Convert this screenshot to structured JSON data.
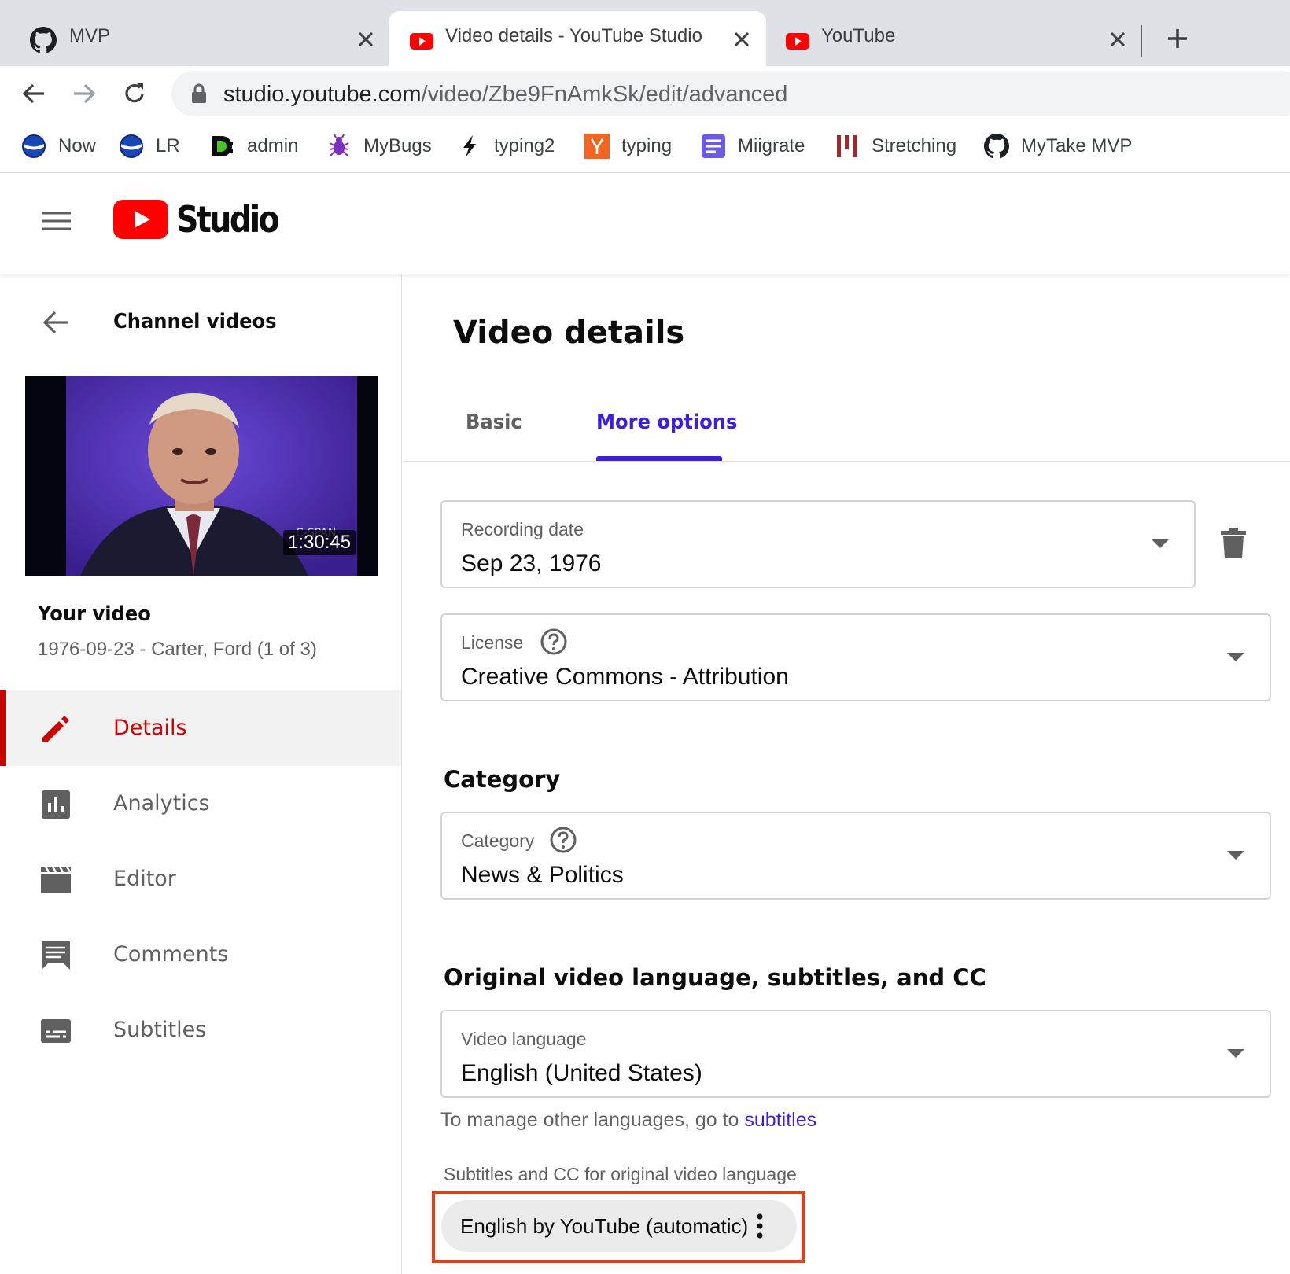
{
  "browser": {
    "tabs": [
      {
        "title": "MVP",
        "icon": "github-icon"
      },
      {
        "title": "Video details - YouTube Studio",
        "icon": "youtube-icon"
      },
      {
        "title": "YouTube",
        "icon": "youtube-icon"
      }
    ],
    "url_host": "studio.youtube.com",
    "url_path": "/video/Zbe9FnAmkSk/edit/advanced",
    "bookmarks": [
      {
        "label": "Now",
        "icon": "globe-badge-icon"
      },
      {
        "label": "LR",
        "icon": "globe-badge-icon"
      },
      {
        "label": "admin",
        "icon": "d-logo-icon"
      },
      {
        "label": "MyBugs",
        "icon": "bug-icon"
      },
      {
        "label": "typing2",
        "icon": "bolt-icon"
      },
      {
        "label": "typing",
        "icon": "y-logo-icon"
      },
      {
        "label": "Miigrate",
        "icon": "doc-icon"
      },
      {
        "label": "Stretching",
        "icon": "bars-icon"
      },
      {
        "label": "MyTake MVP",
        "icon": "github-icon"
      }
    ]
  },
  "header": {
    "logo_text": "Studio"
  },
  "sidebar": {
    "back_label": "Channel videos",
    "duration": "1:30:45",
    "thumb_watermark": "C-SPAN",
    "your_video_label": "Your video",
    "video_title": "1976-09-23 - Carter, Ford (1 of 3)",
    "nav": [
      {
        "label": "Details",
        "icon": "pencil-icon"
      },
      {
        "label": "Analytics",
        "icon": "analytics-icon"
      },
      {
        "label": "Editor",
        "icon": "clapper-icon"
      },
      {
        "label": "Comments",
        "icon": "comment-icon"
      },
      {
        "label": "Subtitles",
        "icon": "subtitles-icon"
      }
    ]
  },
  "main": {
    "page_title": "Video details",
    "tabs": [
      "Basic",
      "More options"
    ],
    "recording_date": {
      "label": "Recording date",
      "value": "Sep 23, 1976"
    },
    "license": {
      "label": "License",
      "value": "Creative Commons - Attribution"
    },
    "category_heading": "Category",
    "category": {
      "label": "Category",
      "value": "News & Politics"
    },
    "language_heading": "Original video language, subtitles, and CC",
    "video_language": {
      "label": "Video language",
      "value": "English (United States)"
    },
    "manage_text": "To manage other languages, go to ",
    "manage_link": "subtitles",
    "subtitles_label": "Subtitles and CC for original video language",
    "subtitle_chip": "English by YouTube (automatic)"
  },
  "colors": {
    "accent": "#3e1fd6",
    "youtube_red": "#ff0000",
    "active_red": "#cc0000",
    "highlight_box": "#e0401a"
  }
}
